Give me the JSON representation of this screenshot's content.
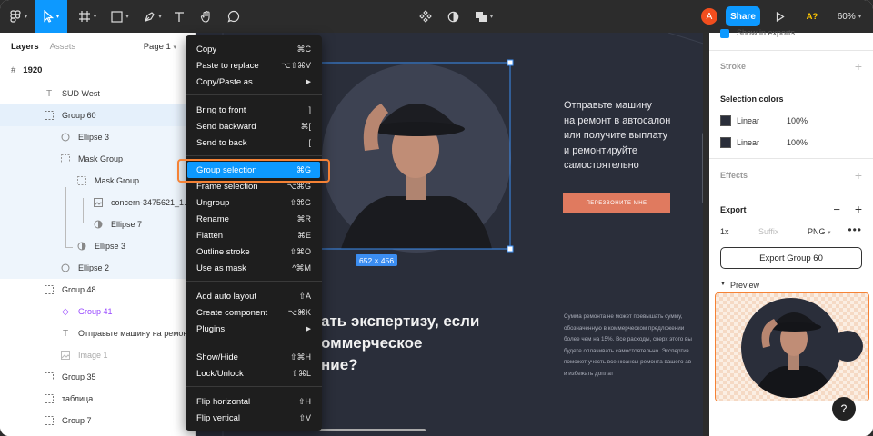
{
  "toolbar": {
    "share_label": "Share",
    "avatar_initial": "A",
    "font_label": "A?",
    "zoom": "60%"
  },
  "layers_panel": {
    "tab_layers": "Layers",
    "tab_assets": "Assets",
    "page_label": "Page 1",
    "frame_name": "1920",
    "items": [
      {
        "label": "SUD West"
      },
      {
        "label": "Group 60"
      },
      {
        "label": "Ellipse 3"
      },
      {
        "label": "Mask Group"
      },
      {
        "label": "Mask Group"
      },
      {
        "label": "concern-3475621_1..."
      },
      {
        "label": "Ellipse 7"
      },
      {
        "label": "Ellipse 3"
      },
      {
        "label": "Ellipse 2"
      },
      {
        "label": "Group 48"
      },
      {
        "label": "Group 41"
      },
      {
        "label": "Отправьте машину на ремон..."
      },
      {
        "label": "Image 1"
      },
      {
        "label": "Group 35"
      },
      {
        "label": "таблица"
      },
      {
        "label": "Group 7"
      }
    ]
  },
  "context_menu": {
    "items": [
      {
        "label": "Copy",
        "shortcut": "⌘C"
      },
      {
        "label": "Paste to replace",
        "shortcut": "⌥⇧⌘V"
      },
      {
        "label": "Copy/Paste as",
        "shortcut": "▶"
      },
      {
        "label": "Bring to front",
        "shortcut": "]"
      },
      {
        "label": "Send backward",
        "shortcut": "⌘["
      },
      {
        "label": "Send to back",
        "shortcut": "["
      },
      {
        "label": "Group selection",
        "shortcut": "⌘G"
      },
      {
        "label": "Frame selection",
        "shortcut": "⌥⌘G"
      },
      {
        "label": "Ungroup",
        "shortcut": "⇧⌘G"
      },
      {
        "label": "Rename",
        "shortcut": "⌘R"
      },
      {
        "label": "Flatten",
        "shortcut": "⌘E"
      },
      {
        "label": "Outline stroke",
        "shortcut": "⇧⌘O"
      },
      {
        "label": "Use as mask",
        "shortcut": "^⌘M"
      },
      {
        "label": "Add auto layout",
        "shortcut": "⇧A"
      },
      {
        "label": "Create component",
        "shortcut": "⌥⌘K"
      },
      {
        "label": "Plugins",
        "shortcut": "▶"
      },
      {
        "label": "Show/Hide",
        "shortcut": "⇧⌘H"
      },
      {
        "label": "Lock/Unlock",
        "shortcut": "⇧⌘L"
      },
      {
        "label": "Flip horizontal",
        "shortcut": "⇧H"
      },
      {
        "label": "Flip vertical",
        "shortcut": "⇧V"
      }
    ]
  },
  "canvas": {
    "size_badge": "652 × 456",
    "promo_text_lines": [
      "Отправьте машину",
      "на ремонт в автосалон",
      "или получите выплату",
      "и ремонтируйте",
      "самостоятельно"
    ],
    "cta_label": "ПЕРЕЗВОНИТЕ МНЕ",
    "heading_lines": [
      "ать экспертизу, если",
      "оммерческое",
      "ние?"
    ],
    "body_lines": [
      "Сумма ремонта не может превышать сумму,",
      "обозначенную в коммерческом предложении",
      "более чем на 15%. Все расходы, сверх этого вы",
      "будете оплачивать самостоятельно. Экспертиз",
      "поможет учесть все нюансы ремонта вашего ав",
      "и избежать доплат"
    ]
  },
  "right_panel": {
    "show_in_exports": "Show in exports",
    "stroke_label": "Stroke",
    "selection_colors_label": "Selection colors",
    "colors": [
      {
        "name": "Linear",
        "opacity": "100%"
      },
      {
        "name": "Linear",
        "opacity": "100%"
      }
    ],
    "effects_label": "Effects",
    "export_label": "Export",
    "export_scale": "1x",
    "suffix_placeholder": "Suffix",
    "export_format": "PNG",
    "export_button": "Export Group 60",
    "preview_label": "Preview",
    "help_label": "?"
  },
  "colors": {
    "accent": "#0d99ff",
    "highlight_outline": "#f58235",
    "canvas_bg": "#2a2e3a",
    "cta": "#e07a5f"
  }
}
